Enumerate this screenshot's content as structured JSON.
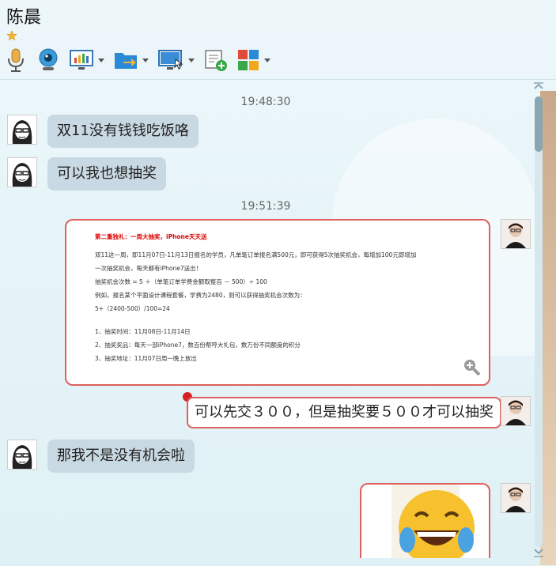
{
  "window": {
    "title": "陈晨",
    "star_icon": "star-icon"
  },
  "toolbar": {
    "items": [
      {
        "name": "microphone-icon",
        "has_dropdown": false
      },
      {
        "name": "webcam-icon",
        "has_dropdown": false
      },
      {
        "name": "screen-share-icon",
        "has_dropdown": true
      },
      {
        "name": "file-transfer-icon",
        "has_dropdown": true
      },
      {
        "name": "remote-desktop-icon",
        "has_dropdown": true
      },
      {
        "name": "add-note-icon",
        "has_dropdown": false
      },
      {
        "name": "apps-icon",
        "has_dropdown": true
      }
    ]
  },
  "messages": {
    "time1": "19:48:30",
    "msg1": "双11没有钱钱吃饭咯",
    "msg2": "可以我也想抽奖",
    "time2": "19:51:39",
    "card": {
      "heading": "第二重独礼：一周大抽奖，iPhone天天送",
      "lines": [
        "双11这一周，即11月07日-11月13日报名的学员，凡单笔订单报名满500元，即可获得5次抽奖机会，每增加100元即增加",
        "一次抽奖机会，每天都有iPhone7送出！",
        "抽奖机会次数 = 5 ＋（单笔订单学费金额取整百 － 500）÷ 100",
        "例如，报名某个平面设计课程套餐，学费为2480，则可以获得抽奖机会次数为：",
        "5+（2400-500）/100=24",
        "",
        "1、抽奖时间：11月08日-11月14日",
        "2、抽奖奖品：每天一部iPhone7，数百份帮哼大礼包，数万份不同额度的积分",
        "3、抽奖地址：11月07日周一晚上放出"
      ]
    },
    "msg3": "可以先交３００，但是抽奖要５００才可以抽奖",
    "msg4": "那我不是没有机会啦"
  }
}
